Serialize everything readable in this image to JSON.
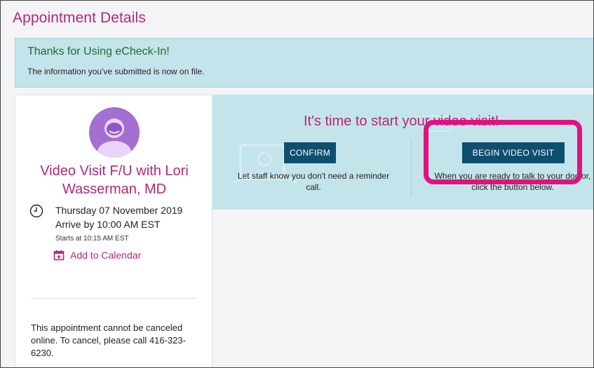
{
  "page": {
    "title": "Appointment Details"
  },
  "banner": {
    "title": "Thanks for Using eCheck-In!",
    "text": "The information you've submitted is now on file."
  },
  "appointment": {
    "title": "Video Visit F/U with Lori Wasserman, MD",
    "date": "Thursday 07 November 2019",
    "arrive": "Arrive by 10:00 AM EST",
    "starts": "Starts at 10:15 AM EST",
    "add_to_calendar": "Add to Calendar",
    "cancel_note": "This appointment cannot be canceled online. To cancel, please call 416-323-6230."
  },
  "video": {
    "heading": "It's time to start your video visit!",
    "confirm_label": "CONFIRM",
    "confirm_caption": "Let staff know you don't need a reminder call.",
    "begin_label": "BEGIN VIDEO VISIT",
    "begin_caption": "When you are ready to talk to your doctor, click the button below."
  },
  "colors": {
    "accent": "#b5267a",
    "button": "#0e4f6e",
    "banner_bg": "#c4e4eb",
    "banner_title": "#1f6a2c",
    "highlight": "#e0127f"
  },
  "icons": [
    "user-avatar-icon",
    "clock-icon",
    "calendar-icon"
  ]
}
